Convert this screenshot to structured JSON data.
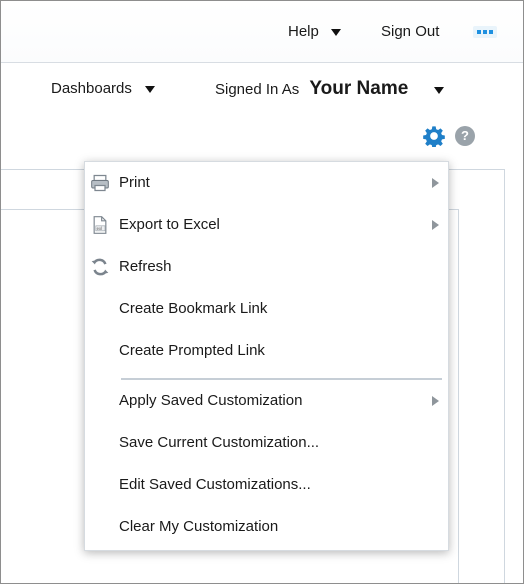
{
  "header": {
    "help_label": "Help",
    "sign_out_label": "Sign Out",
    "dashboards_label": "Dashboards",
    "signed_in_as_label": "Signed In As",
    "user_name": "Your Name"
  },
  "toolbar": {
    "help_icon_text": "?"
  },
  "menu": {
    "items": [
      {
        "label": "Print",
        "icon": "printer-icon",
        "submenu": true
      },
      {
        "label": "Export to Excel",
        "icon": "excel-file-icon",
        "submenu": true
      },
      {
        "label": "Refresh",
        "icon": "refresh-icon",
        "submenu": false
      },
      {
        "label": "Create Bookmark Link",
        "icon": "",
        "submenu": false
      },
      {
        "label": "Create Prompted Link",
        "icon": "",
        "submenu": false
      },
      {
        "label": "Apply Saved Customization",
        "icon": "",
        "submenu": true
      },
      {
        "label": "Save Current Customization...",
        "icon": "",
        "submenu": false
      },
      {
        "label": "Edit Saved Customizations...",
        "icon": "",
        "submenu": false
      },
      {
        "label": "Clear My Customization",
        "icon": "",
        "submenu": false
      }
    ]
  },
  "colors": {
    "accent_blue": "#1e90e0",
    "gear_blue": "#1f7fc8",
    "border_gray": "#cfd7df",
    "submenu_arrow": "#8f969c"
  }
}
